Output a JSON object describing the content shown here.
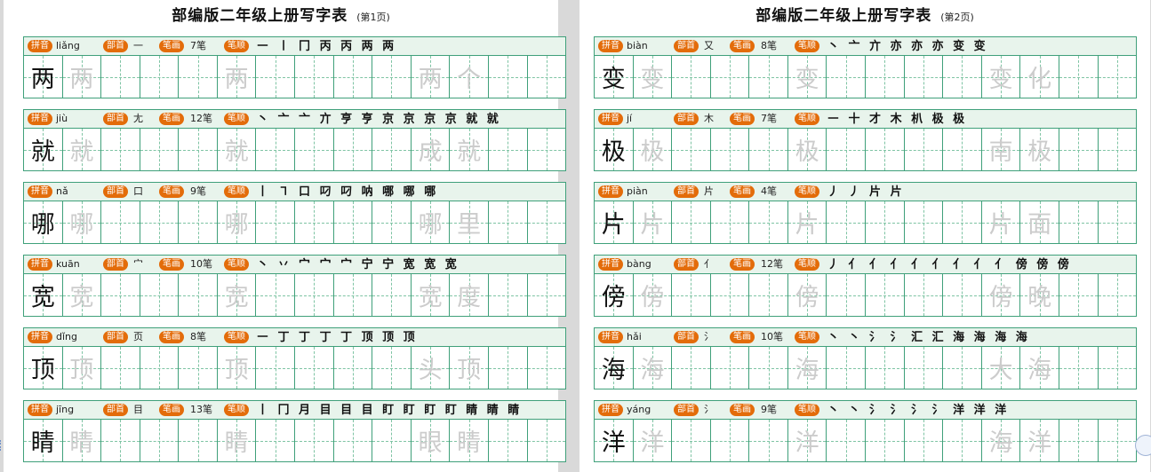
{
  "labels": {
    "pinyin": "拼音",
    "radical": "部首",
    "count": "笔画",
    "order": "笔顺"
  },
  "pages": [
    {
      "title": "部编版二年级上册写字表",
      "page_no": "(第1页)",
      "rows": [
        {
          "char": "两",
          "pinyin": "liǎng",
          "radical": "一",
          "count": "7笔",
          "strokes": "㇐ ㇑ 冂 丙 丙 两 两",
          "words": [
            "两",
            "个"
          ]
        },
        {
          "char": "就",
          "pinyin": "jiù",
          "radical": "尢",
          "count": "12笔",
          "strokes": "丶 亠 亠 亣 亨 亨 京 京 京 京 就 就",
          "words": [
            "成",
            "就"
          ]
        },
        {
          "char": "哪",
          "pinyin": "nǎ",
          "radical": "口",
          "count": "9笔",
          "strokes": "丨 ㇕ 口 叼 叼 呐 哪 哪 哪",
          "words": [
            "哪",
            "里"
          ]
        },
        {
          "char": "宽",
          "pinyin": "kuān",
          "radical": "宀",
          "count": "10笔",
          "strokes": "丶 丷 宀 宀 宀 宁 宁 宽 宽 宽",
          "words": [
            "宽",
            "度"
          ]
        },
        {
          "char": "顶",
          "pinyin": "dǐng",
          "radical": "页",
          "count": "8笔",
          "strokes": "㇐ 丁 丁 丁 丁 顶 顶 顶",
          "words": [
            "头",
            "顶"
          ]
        },
        {
          "char": "睛",
          "pinyin": "jīng",
          "radical": "目",
          "count": "13笔",
          "strokes": "丨 冂 月 目 目 目 盯 盯 盯 盯 睛 睛 睛",
          "words": [
            "眼",
            "睛"
          ]
        }
      ]
    },
    {
      "title": "部编版二年级上册写字表",
      "page_no": "(第2页)",
      "rows": [
        {
          "char": "变",
          "pinyin": "biàn",
          "radical": "又",
          "count": "8笔",
          "strokes": "丶 亠 亣 亦 亦 亦 变 变",
          "words": [
            "变",
            "化"
          ]
        },
        {
          "char": "极",
          "pinyin": "jí",
          "radical": "木",
          "count": "7笔",
          "strokes": "㇐ 十 才 木 朳 极 极",
          "words": [
            "南",
            "极"
          ]
        },
        {
          "char": "片",
          "pinyin": "piàn",
          "radical": "片",
          "count": "4笔",
          "strokes": "丿 丿 片 片",
          "words": [
            "片",
            "面"
          ]
        },
        {
          "char": "傍",
          "pinyin": "bàng",
          "radical": "亻",
          "count": "12笔",
          "strokes": "丿 亻 亻 亻 亻 亻 亻 亻 亻 傍 傍 傍",
          "words": [
            "傍",
            "晚"
          ]
        },
        {
          "char": "海",
          "pinyin": "hǎi",
          "radical": "氵",
          "count": "10笔",
          "strokes": "丶 丶 氵 氵 汇 汇 海 海 海 海",
          "words": [
            "大",
            "海"
          ]
        },
        {
          "char": "洋",
          "pinyin": "yáng",
          "radical": "氵",
          "count": "9笔",
          "strokes": "丶 丶 氵 氵 氵 氵 洋 洋 洋",
          "words": [
            "海",
            "洋"
          ]
        }
      ]
    }
  ]
}
